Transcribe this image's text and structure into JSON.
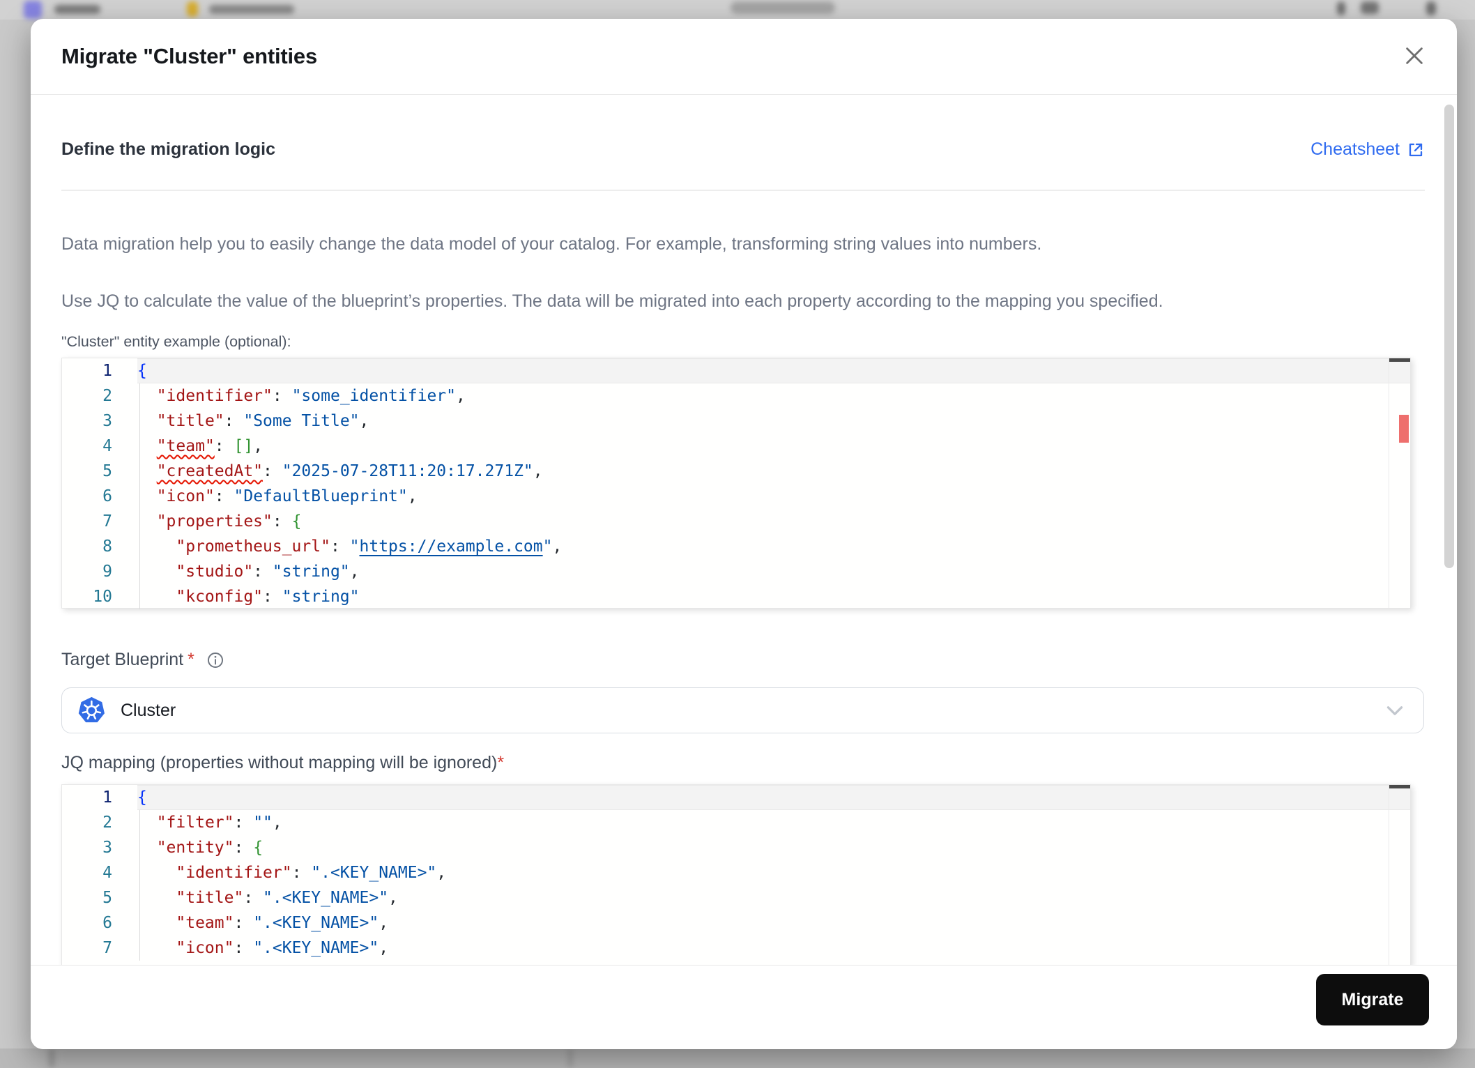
{
  "modal": {
    "title": "Migrate \"Cluster\" entities",
    "section": {
      "heading": "Define the migration logic",
      "cheatsheet_label": "Cheatsheet",
      "description1": "Data migration help you to easily change the data model of your catalog. For example, transforming string values into numbers.",
      "description2": "Use JQ to calculate the value of the blueprint’s properties. The data will be migrated into each property according to the mapping you specified."
    },
    "example_editor": {
      "label": "\"Cluster\" entity example (optional):",
      "lines": [
        {
          "num": 1,
          "cur": true,
          "tokens": [
            [
              "{",
              "b0"
            ]
          ]
        },
        {
          "num": 2,
          "tokens": [
            [
              "  ",
              "w"
            ],
            [
              "\"identifier\"",
              "k"
            ],
            [
              ": ",
              "p"
            ],
            [
              "\"some_identifier\"",
              "v"
            ],
            [
              ",",
              "p"
            ]
          ]
        },
        {
          "num": 3,
          "tokens": [
            [
              "  ",
              "w"
            ],
            [
              "\"title\"",
              "k"
            ],
            [
              ": ",
              "p"
            ],
            [
              "\"Some Title\"",
              "v"
            ],
            [
              ",",
              "p"
            ]
          ]
        },
        {
          "num": 4,
          "tokens": [
            [
              "  ",
              "w"
            ],
            [
              "\"team\"",
              "ks"
            ],
            [
              ": ",
              "p"
            ],
            [
              "[]",
              "b1"
            ],
            [
              ",",
              "p"
            ]
          ]
        },
        {
          "num": 5,
          "tokens": [
            [
              "  ",
              "w"
            ],
            [
              "\"createdAt\"",
              "ks"
            ],
            [
              ": ",
              "p"
            ],
            [
              "\"2025-07-28T11:20:17.271Z\"",
              "v"
            ],
            [
              ",",
              "p"
            ]
          ]
        },
        {
          "num": 6,
          "tokens": [
            [
              "  ",
              "w"
            ],
            [
              "\"icon\"",
              "k"
            ],
            [
              ": ",
              "p"
            ],
            [
              "\"DefaultBlueprint\"",
              "v"
            ],
            [
              ",",
              "p"
            ]
          ]
        },
        {
          "num": 7,
          "tokens": [
            [
              "  ",
              "w"
            ],
            [
              "\"properties\"",
              "k"
            ],
            [
              ": ",
              "p"
            ],
            [
              "{",
              "b1"
            ]
          ]
        },
        {
          "num": 8,
          "tokens": [
            [
              "    ",
              "w"
            ],
            [
              "\"prometheus_url\"",
              "k"
            ],
            [
              ": ",
              "p"
            ],
            [
              "\"",
              "v"
            ],
            [
              "https://example.com",
              "vl"
            ],
            [
              "\"",
              "v"
            ],
            [
              ",",
              "p"
            ]
          ]
        },
        {
          "num": 9,
          "tokens": [
            [
              "    ",
              "w"
            ],
            [
              "\"studio\"",
              "k"
            ],
            [
              ": ",
              "p"
            ],
            [
              "\"string\"",
              "v"
            ],
            [
              ",",
              "p"
            ]
          ]
        },
        {
          "num": 10,
          "tokens": [
            [
              "    ",
              "w"
            ],
            [
              "\"kconfig\"",
              "k"
            ],
            [
              ": ",
              "p"
            ],
            [
              "\"string\"",
              "v"
            ]
          ]
        }
      ]
    },
    "target_blueprint": {
      "label": "Target Blueprint",
      "required_mark": "*",
      "value": "Cluster",
      "icon": "kubernetes-icon"
    },
    "jq_editor": {
      "label": "JQ mapping (properties without mapping will be ignored)",
      "required_mark": "*",
      "lines": [
        {
          "num": 1,
          "cur": true,
          "tokens": [
            [
              "{",
              "b0"
            ]
          ]
        },
        {
          "num": 2,
          "tokens": [
            [
              "  ",
              "w"
            ],
            [
              "\"filter\"",
              "k"
            ],
            [
              ": ",
              "p"
            ],
            [
              "\"\"",
              "v"
            ],
            [
              ",",
              "p"
            ]
          ]
        },
        {
          "num": 3,
          "tokens": [
            [
              "  ",
              "w"
            ],
            [
              "\"entity\"",
              "k"
            ],
            [
              ": ",
              "p"
            ],
            [
              "{",
              "b1"
            ]
          ]
        },
        {
          "num": 4,
          "tokens": [
            [
              "    ",
              "w"
            ],
            [
              "\"identifier\"",
              "k"
            ],
            [
              ": ",
              "p"
            ],
            [
              "\".<KEY_NAME>\"",
              "v"
            ],
            [
              ",",
              "p"
            ]
          ]
        },
        {
          "num": 5,
          "tokens": [
            [
              "    ",
              "w"
            ],
            [
              "\"title\"",
              "k"
            ],
            [
              ": ",
              "p"
            ],
            [
              "\".<KEY_NAME>\"",
              "v"
            ],
            [
              ",",
              "p"
            ]
          ]
        },
        {
          "num": 6,
          "tokens": [
            [
              "    ",
              "w"
            ],
            [
              "\"team\"",
              "k"
            ],
            [
              ": ",
              "p"
            ],
            [
              "\".<KEY_NAME>\"",
              "v"
            ],
            [
              ",",
              "p"
            ]
          ]
        },
        {
          "num": 7,
          "tokens": [
            [
              "    ",
              "w"
            ],
            [
              "\"icon\"",
              "k"
            ],
            [
              ": ",
              "p"
            ],
            [
              "\".<KEY_NAME>\"",
              "v"
            ],
            [
              ",",
              "p"
            ]
          ]
        }
      ]
    },
    "footer": {
      "migrate_label": "Migrate"
    },
    "icons": {
      "close": "close-icon",
      "external_link": "external-link-icon",
      "info": "info-icon",
      "chevron_down": "chevron-down-icon",
      "kubernetes": "kubernetes-icon"
    },
    "colors": {
      "link": "#2F6BF0",
      "kubernetes_blue": "#326CE5",
      "button_bg": "#0D0D0D",
      "button_text": "#FFFFFF",
      "required_red": "#D3382F",
      "error_marker": "#EE6F6D"
    },
    "code_colors": {
      "key": "#A31515",
      "value": "#0451A5",
      "bracket_outer": "#0431FA",
      "bracket_inner": "#319331",
      "punctuation": "#24292E",
      "line_number": "#237893",
      "line_number_active": "#0B216F"
    }
  }
}
